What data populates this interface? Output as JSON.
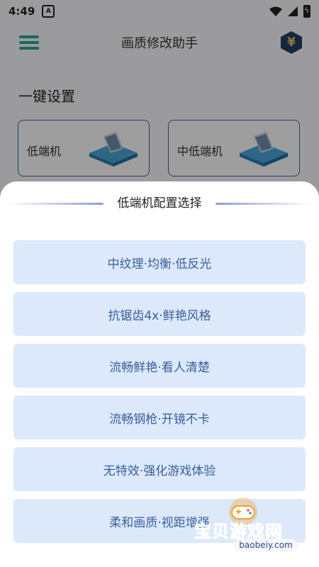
{
  "status_bar": {
    "time": "4:49",
    "a_icon": "A",
    "icons": [
      "wifi-icon",
      "signal-icon",
      "battery-icon"
    ]
  },
  "header": {
    "title": "画质修改助手",
    "menu_icon": "menu-icon",
    "yen_icon": "yen-hexagon-icon",
    "yen_symbol": "¥"
  },
  "section": {
    "title": "一键设置",
    "cards": [
      {
        "label": "低端机"
      },
      {
        "label": "中低端机"
      }
    ]
  },
  "sheet": {
    "title": "低端机配置选择",
    "options": [
      "中纹理·均衡·低反光",
      "抗锯齿4x·鲜艳风格",
      "流畅鲜艳·看人清楚",
      "流畅钢枪·开镜不卡",
      "无特效·强化游戏体验",
      "柔和画质·视距增强"
    ]
  },
  "watermark": {
    "text": "宝贝游戏网",
    "url": "baobeiy.com"
  },
  "colors": {
    "accent": "#27a99a",
    "option_bg": "#dbe9fb",
    "option_text": "#3d5e99",
    "card_border": "#3c6a9a"
  }
}
